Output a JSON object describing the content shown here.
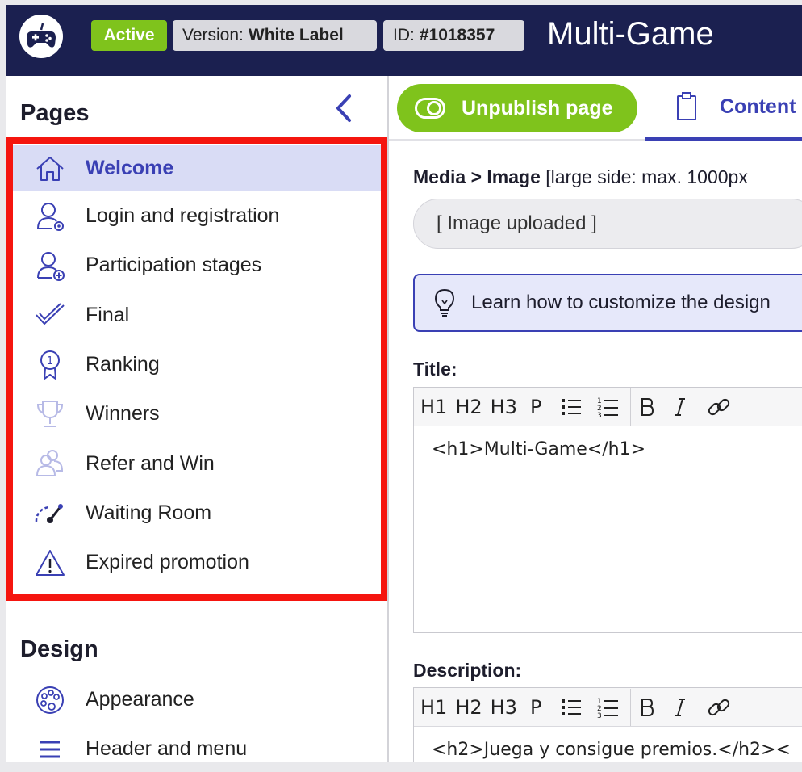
{
  "header": {
    "logo_icon": "gamepad-icon",
    "status": "Active",
    "version_label": "Version:",
    "version_value": "White Label",
    "id_label": "ID:",
    "id_value": "#1018357",
    "title": "Multi-Game"
  },
  "sidebar": {
    "pages_title": "Pages",
    "collapse_icon": "chevron-left-icon",
    "pages": [
      {
        "label": "Welcome",
        "icon": "home-icon",
        "active": true
      },
      {
        "label": "Login and registration",
        "icon": "user-at-icon"
      },
      {
        "label": "Participation stages",
        "icon": "user-plus-icon"
      },
      {
        "label": "Final",
        "icon": "check-icon"
      },
      {
        "label": "Ranking",
        "icon": "medal-icon"
      },
      {
        "label": "Winners",
        "icon": "trophy-icon"
      },
      {
        "label": "Refer and Win",
        "icon": "people-icon"
      },
      {
        "label": "Waiting Room",
        "icon": "gauge-icon"
      },
      {
        "label": "Expired promotion",
        "icon": "warning-icon"
      }
    ],
    "design_title": "Design",
    "design": [
      {
        "label": "Appearance",
        "icon": "palette-icon"
      },
      {
        "label": "Header and menu",
        "icon": "menu-icon"
      }
    ]
  },
  "main": {
    "unpublish_label": "Unpublish page",
    "tab_content_label": "Content",
    "media_label_bold": "Media > Image",
    "media_hint": "[large side: max. 1000px",
    "image_value": "[ Image uploaded ]",
    "tip_text": "Learn how to customize the design",
    "title_label": "Title:",
    "title_value": "<h1>Multi-Game</h1>",
    "description_label": "Description:",
    "description_value": "<h2>Juega y consigue premios.</h2><",
    "toolbar": [
      "H1",
      "H2",
      "H3",
      "P"
    ]
  },
  "colors": {
    "navy": "#1b2050",
    "green": "#7fc31c",
    "accent": "#3a40b4",
    "highlight_border": "#f5150f",
    "active_bg": "#d9dcf5"
  }
}
